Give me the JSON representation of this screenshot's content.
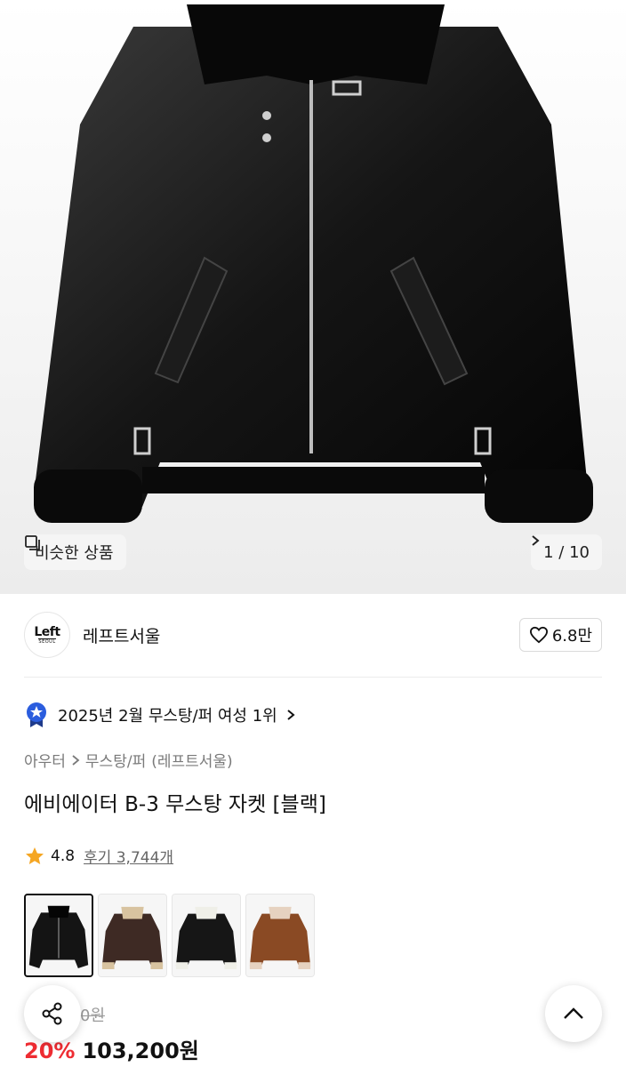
{
  "gallery": {
    "similar_label": "비슷한 상품",
    "counter": "1 / 10"
  },
  "brand": {
    "logo_line1": "Left",
    "logo_line2": "SEOUL",
    "name": "레프트서울",
    "likes": "6.8만"
  },
  "rank": {
    "text": "2025년 2월 무스탕/퍼 여성 1위"
  },
  "breadcrumb": {
    "items": [
      "아우터",
      "무스탕/퍼"
    ],
    "brand": "(레프트서울)"
  },
  "product": {
    "title": "에비에이터 B-3 무스탕 자켓 [블랙]",
    "rating": "4.8",
    "reviews": "후기 3,744개",
    "original_price": "0원",
    "discount": "20%",
    "price": "103,200원"
  },
  "colors": {
    "accent_red": "#ee2c32",
    "star": "#f5a623",
    "badge_blue": "#2b5dde"
  },
  "icons": {
    "similar": "similar-items-icon",
    "chevron": "chevron-right-icon",
    "heart": "heart-icon",
    "rank_badge": "rank-badge-icon",
    "star": "star-icon",
    "share": "share-icon",
    "top": "chevron-up-icon"
  }
}
